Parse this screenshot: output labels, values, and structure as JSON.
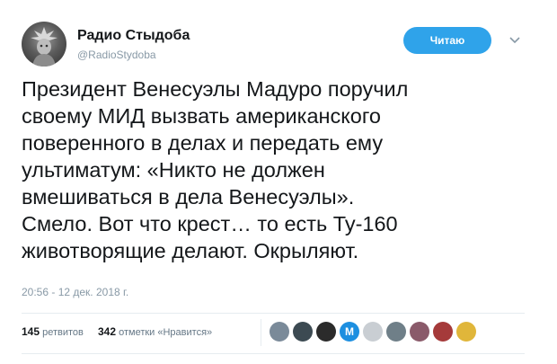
{
  "author": {
    "name": "Радио Стыдоба",
    "handle": "@RadioStydoba",
    "avatar_icon": "statue-of-liberty-avatar"
  },
  "follow_button": {
    "label": "Читаю",
    "color": "#2fa3ea"
  },
  "menu_icon": "chevron-down-icon",
  "tweet": {
    "text": "Президент Венесуэлы Мадуро поручил\nсвоему МИД вызвать американского\nповеренного в делах и передать ему\nультиматум: «Никто не должен\nвмешиваться в дела Венесуэлы».\nСмело. Вот что крест… то есть Ту-160\nживотворящие делают. Окрыляют.",
    "timestamp": "20:56 - 12 дек. 2018 г."
  },
  "stats": {
    "retweets_count": "145",
    "retweets_label": "ретвитов",
    "likes_count": "342",
    "likes_label": "отметки «Нравится»"
  },
  "likers": [
    {
      "icon": "user-avatar",
      "color": "#7a8a99"
    },
    {
      "icon": "user-avatar",
      "color": "#3c4a52"
    },
    {
      "icon": "user-avatar",
      "color": "#2b2b2b"
    },
    {
      "icon": "metro-logo-avatar",
      "color": "#1d8fe0"
    },
    {
      "icon": "user-avatar",
      "color": "#c9ced3"
    },
    {
      "icon": "user-avatar",
      "color": "#6f7f88"
    },
    {
      "icon": "user-avatar",
      "color": "#8a5a6a"
    },
    {
      "icon": "user-avatar",
      "color": "#a53a3a"
    },
    {
      "icon": "user-avatar",
      "color": "#e0b63a"
    }
  ]
}
